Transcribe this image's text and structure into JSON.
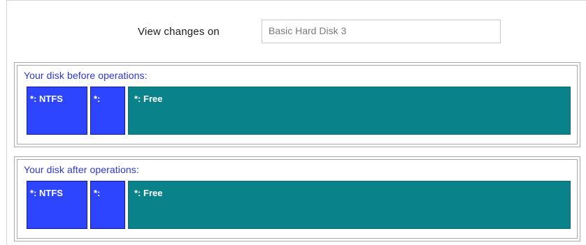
{
  "view_changes": {
    "label": "View changes on",
    "selected_disk": "Basic Hard Disk 3"
  },
  "before": {
    "title": "Your disk before operations:",
    "partitions": [
      {
        "label": "*: NTFS",
        "color": "#2e45ff"
      },
      {
        "label": "*:",
        "color": "#2e45ff"
      },
      {
        "label": "*: Free",
        "color": "#0a8289"
      }
    ]
  },
  "after": {
    "title": "Your disk after operations:",
    "partitions": [
      {
        "label": "*: NTFS",
        "color": "#2e45ff"
      },
      {
        "label": "*:",
        "color": "#2e45ff"
      },
      {
        "label": "*: Free",
        "color": "#0a8289"
      }
    ]
  }
}
